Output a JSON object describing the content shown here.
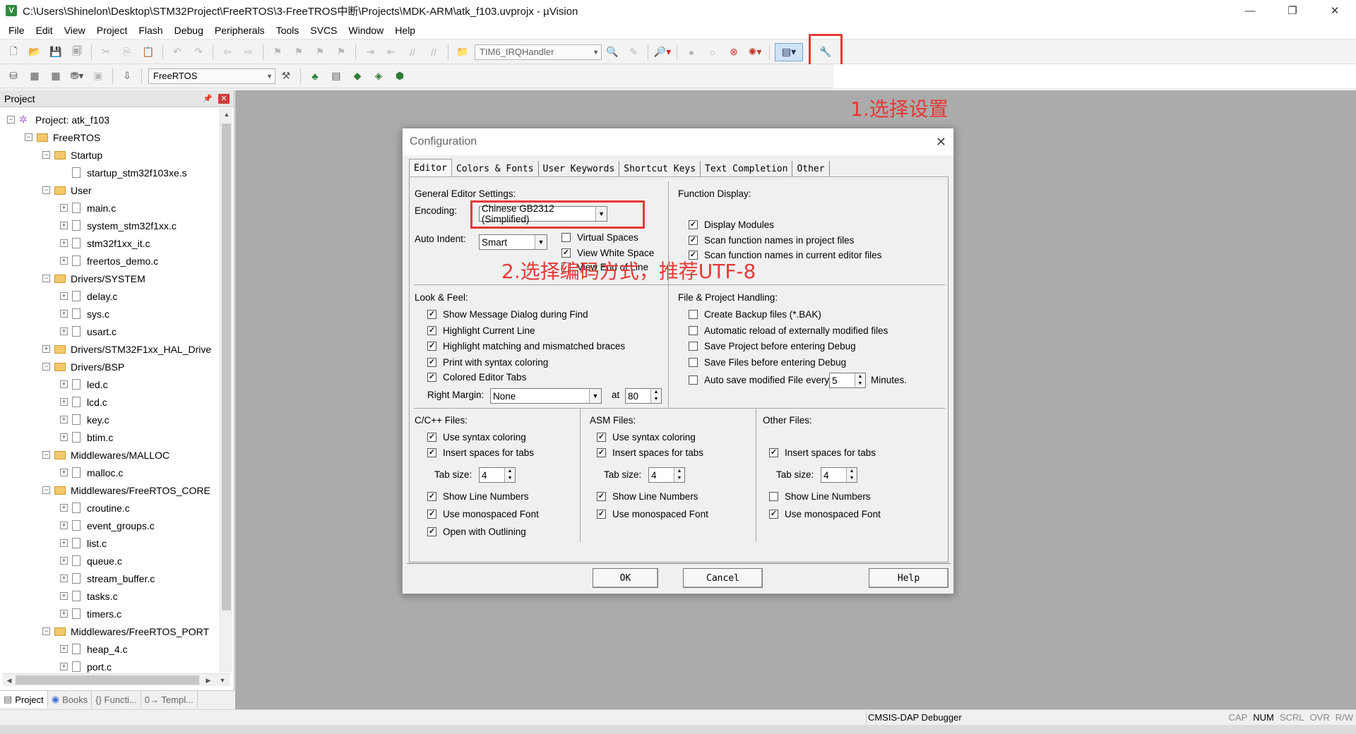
{
  "window": {
    "title": "C:\\Users\\Shinelon\\Desktop\\STM32Project\\FreeRTOS\\3-FreeTROS中断\\Projects\\MDK-ARM\\atk_f103.uvprojx - µVision",
    "icon_text": "V",
    "min": "—",
    "max": "❐",
    "close": "✕"
  },
  "menu": [
    "File",
    "Edit",
    "View",
    "Project",
    "Flash",
    "Debug",
    "Peripherals",
    "Tools",
    "SVCS",
    "Window",
    "Help"
  ],
  "toolbar1": {
    "function_combo": "TIM6_IRQHandler"
  },
  "toolbar2": {
    "target_combo": "FreeRTOS"
  },
  "annotations": {
    "step1": "1.选择设置",
    "step2": "2.选择编码方式，推荐UTF-8"
  },
  "project_panel": {
    "title": "Project",
    "pin": "📌",
    "close": "✕",
    "tree": [
      {
        "label": "Project: atk_f103",
        "level": 0,
        "kind": "project",
        "exp": "−"
      },
      {
        "label": "FreeRTOS",
        "level": 1,
        "kind": "folder",
        "exp": "−"
      },
      {
        "label": "Startup",
        "level": 2,
        "kind": "folder",
        "exp": "−"
      },
      {
        "label": "startup_stm32f103xe.s",
        "level": 3,
        "kind": "file",
        "exp": ""
      },
      {
        "label": "User",
        "level": 2,
        "kind": "folder",
        "exp": "−"
      },
      {
        "label": "main.c",
        "level": 3,
        "kind": "file",
        "exp": "+"
      },
      {
        "label": "system_stm32f1xx.c",
        "level": 3,
        "kind": "file",
        "exp": "+"
      },
      {
        "label": "stm32f1xx_it.c",
        "level": 3,
        "kind": "file",
        "exp": "+"
      },
      {
        "label": "freertos_demo.c",
        "level": 3,
        "kind": "file",
        "exp": "+"
      },
      {
        "label": "Drivers/SYSTEM",
        "level": 2,
        "kind": "folder",
        "exp": "−"
      },
      {
        "label": "delay.c",
        "level": 3,
        "kind": "file",
        "exp": "+"
      },
      {
        "label": "sys.c",
        "level": 3,
        "kind": "file",
        "exp": "+"
      },
      {
        "label": "usart.c",
        "level": 3,
        "kind": "file",
        "exp": "+"
      },
      {
        "label": "Drivers/STM32F1xx_HAL_Drive",
        "level": 2,
        "kind": "folder",
        "exp": "+"
      },
      {
        "label": "Drivers/BSP",
        "level": 2,
        "kind": "folder",
        "exp": "−"
      },
      {
        "label": "led.c",
        "level": 3,
        "kind": "file",
        "exp": "+"
      },
      {
        "label": "lcd.c",
        "level": 3,
        "kind": "file",
        "exp": "+"
      },
      {
        "label": "key.c",
        "level": 3,
        "kind": "file",
        "exp": "+"
      },
      {
        "label": "btim.c",
        "level": 3,
        "kind": "file",
        "exp": "+"
      },
      {
        "label": "Middlewares/MALLOC",
        "level": 2,
        "kind": "folder",
        "exp": "−"
      },
      {
        "label": "malloc.c",
        "level": 3,
        "kind": "file",
        "exp": "+"
      },
      {
        "label": "Middlewares/FreeRTOS_CORE",
        "level": 2,
        "kind": "folder",
        "exp": "−"
      },
      {
        "label": "croutine.c",
        "level": 3,
        "kind": "file",
        "exp": "+"
      },
      {
        "label": "event_groups.c",
        "level": 3,
        "kind": "file",
        "exp": "+"
      },
      {
        "label": "list.c",
        "level": 3,
        "kind": "file",
        "exp": "+"
      },
      {
        "label": "queue.c",
        "level": 3,
        "kind": "file",
        "exp": "+"
      },
      {
        "label": "stream_buffer.c",
        "level": 3,
        "kind": "file",
        "exp": "+"
      },
      {
        "label": "tasks.c",
        "level": 3,
        "kind": "file",
        "exp": "+"
      },
      {
        "label": "timers.c",
        "level": 3,
        "kind": "file",
        "exp": "+"
      },
      {
        "label": "Middlewares/FreeRTOS_PORT",
        "level": 2,
        "kind": "folder",
        "exp": "−"
      },
      {
        "label": "heap_4.c",
        "level": 3,
        "kind": "file",
        "exp": "+"
      },
      {
        "label": "port.c",
        "level": 3,
        "kind": "file",
        "exp": "+"
      }
    ],
    "tabs": [
      "Project",
      "Books",
      "{} Functi...",
      "0→ Templ..."
    ]
  },
  "dialog": {
    "title": "Configuration",
    "close": "✕",
    "tabs": [
      "Editor",
      "Colors & Fonts",
      "User Keywords",
      "Shortcut Keys",
      "Text Completion",
      "Other"
    ],
    "general": {
      "title": "General Editor Settings:",
      "encoding_label": "Encoding:",
      "encoding_value": "Chinese GB2312 (Simplified)",
      "auto_indent_label": "Auto Indent:",
      "auto_indent_value": "Smart",
      "virtual_spaces": "Virtual Spaces",
      "view_white_space": "View White Space",
      "view_end_of_line": "View End of Line"
    },
    "function_display": {
      "title": "Function Display:",
      "items": [
        "Display Modules",
        "Scan function names in project files",
        "Scan function names in current editor files"
      ]
    },
    "look_feel": {
      "title": "Look & Feel:",
      "items": [
        "Show Message Dialog during Find",
        "Highlight Current Line",
        "Highlight matching and mismatched braces",
        "Print with syntax coloring",
        "Colored Editor Tabs"
      ],
      "right_margin_label": "Right Margin:",
      "right_margin_value": "None",
      "at_label": "at",
      "at_value": "80"
    },
    "file_handling": {
      "title": "File & Project Handling:",
      "items": [
        "Create Backup files (*.BAK)",
        "Automatic reload of externally modified files",
        "Save Project before entering Debug",
        "Save Files before entering Debug",
        "Auto save modified File every"
      ],
      "minutes_value": "5",
      "minutes_label": "Minutes."
    },
    "cpp": {
      "title": "C/C++ Files:",
      "syntax": "Use syntax coloring",
      "spaces": "Insert spaces for tabs",
      "tab_label": "Tab size:",
      "tab_value": "4",
      "line_numbers": "Show Line Numbers",
      "mono": "Use monospaced Font",
      "outlining": "Open with Outlining"
    },
    "asm": {
      "title": "ASM Files:",
      "syntax": "Use syntax coloring",
      "spaces": "Insert spaces for tabs",
      "tab_label": "Tab size:",
      "tab_value": "4",
      "line_numbers": "Show Line Numbers",
      "mono": "Use monospaced Font"
    },
    "other": {
      "title": "Other Files:",
      "spaces": "Insert spaces for tabs",
      "tab_label": "Tab size:",
      "tab_value": "4",
      "line_numbers": "Show Line Numbers",
      "mono": "Use monospaced Font"
    },
    "buttons": {
      "ok": "OK",
      "cancel": "Cancel",
      "help": "Help"
    }
  },
  "status": {
    "debugger": "CMSIS-DAP Debugger",
    "indicators": [
      "CAP",
      "NUM",
      "SCRL",
      "OVR",
      "R/W"
    ]
  },
  "colors": {
    "annotation_red": "#e53935",
    "workspace_gray": "#ababab"
  }
}
